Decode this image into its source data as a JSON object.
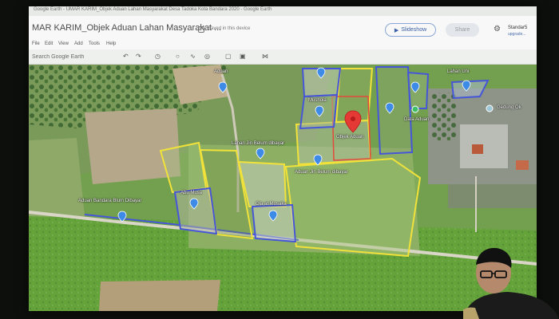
{
  "browser_tab": {
    "title": "Google Earth - UMAR KARIM_Objek Aduan Lahan Masyarakat Desa Tadoka Kota Bandara 2020 - Google Earth"
  },
  "header": {
    "doc_title": "MAR KARIM_Objek Aduan Lahan Masyarakat ...",
    "saved_status": "Saved in this device",
    "slideshow_label": "Slideshow",
    "share_label": "Share",
    "user_name": "Standar5",
    "user_email": "upgrade..."
  },
  "menu": {
    "items": [
      "File",
      "Edit",
      "View",
      "Add",
      "Tools",
      "Help"
    ]
  },
  "toolbar": {
    "search_placeholder": "Search Google Earth",
    "icons": [
      "undo-icon",
      "redo-icon",
      "history-icon",
      "pin-icon",
      "path-icon",
      "location-icon",
      "rectangle-icon",
      "image-icon",
      "ruler-icon"
    ]
  },
  "map_labels": {
    "a": "Aduan",
    "b": "Mushola",
    "c": "Lahan Uni",
    "d": "Lahan Jin Belum dibayar",
    "e": "Objek Aduan",
    "f": "Data Aduan",
    "g": "Gedung Ok",
    "h": "Aduan Jin Belum dibayar",
    "i": "Aduan Bandara Blum Dibayar",
    "j": "Abu Musa",
    "k": "Ola at Mosaka"
  },
  "colors": {
    "parcel_yellow": "#f0e23a",
    "parcel_blue": "#4656d8",
    "parcel_red": "#e34a3c",
    "marker_red": "#e53935",
    "accent_blue": "#3f63a8"
  }
}
